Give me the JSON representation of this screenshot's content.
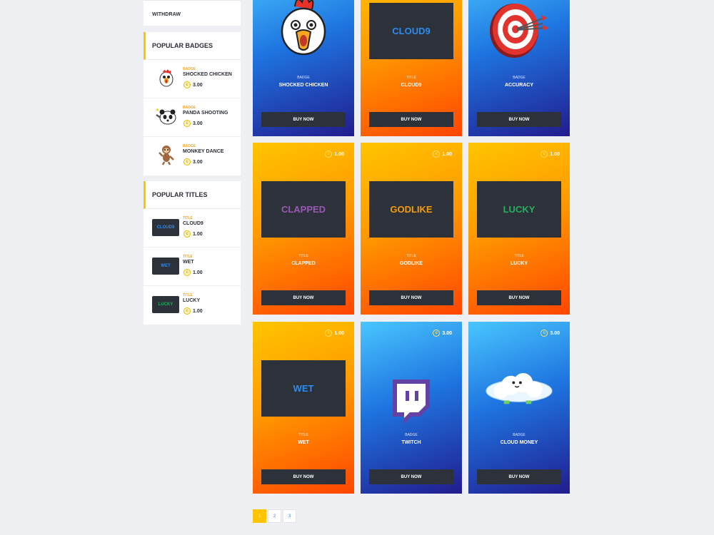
{
  "sidebar": {
    "withdraw_label": "WITHDRAW",
    "badges": {
      "title": "POPULAR BADGES",
      "items": [
        {
          "type": "BADGE",
          "name": "SHOCKED CHICKEN",
          "price": "3.00",
          "icon": "chicken-icon"
        },
        {
          "type": "BADGE",
          "name": "PANDA SHOOTING",
          "price": "3.00",
          "icon": "panda-icon"
        },
        {
          "type": "BADGE",
          "name": "MONKEY DANCE",
          "price": "3.00",
          "icon": "monkey-icon"
        }
      ]
    },
    "titles": {
      "title": "POPULAR TITLES",
      "items": [
        {
          "type": "TITLE",
          "name": "CLOUD9",
          "price": "1.00",
          "thumb": "CLOUD9",
          "color": "#2d8cf0"
        },
        {
          "type": "TITLE",
          "name": "WET",
          "price": "1.00",
          "thumb": "WET",
          "color": "#2d8cf0"
        },
        {
          "type": "TITLE",
          "name": "LUCKY",
          "price": "1.00",
          "thumb": "LUCKY",
          "color": "#27ae60"
        }
      ]
    }
  },
  "cards": [
    {
      "kind": "badge",
      "type": "BADGE",
      "name": "SHOCKED CHICKEN",
      "button": "BUY NOW",
      "icon": "chicken-icon",
      "bg": "blue"
    },
    {
      "kind": "title",
      "type": "TITLE",
      "name": "CLOUD9",
      "button": "BUY NOW",
      "display": "CLOUD9",
      "color": "#2d8cf0",
      "bg": "orange"
    },
    {
      "kind": "badge",
      "type": "BADGE",
      "name": "ACCURACY",
      "button": "BUY NOW",
      "icon": "target-icon",
      "bg": "blue"
    },
    {
      "kind": "title",
      "type": "TITLE",
      "name": "CLAPPED",
      "button": "BUY NOW",
      "display": "CLAPPED",
      "color": "#9b59b6",
      "price": "1.00",
      "bg": "orange"
    },
    {
      "kind": "title",
      "type": "TITLE",
      "name": "GODLIKE",
      "button": "BUY NOW",
      "display": "GODLIKE",
      "color": "#f39c12",
      "price": "1.00",
      "bg": "orange"
    },
    {
      "kind": "title",
      "type": "TITLE",
      "name": "LUCKY",
      "button": "BUY NOW",
      "display": "LUCKY",
      "color": "#27ae60",
      "price": "1.00",
      "bg": "orange"
    },
    {
      "kind": "title",
      "type": "TITLE",
      "name": "WET",
      "button": "BUY NOW",
      "display": "WET",
      "color": "#2d8cf0",
      "price": "1.00",
      "bg": "orange"
    },
    {
      "kind": "badge",
      "type": "BADGE",
      "name": "TWITCH",
      "button": "BUY NOW",
      "icon": "twitch-icon",
      "price": "3.00",
      "bg": "blue"
    },
    {
      "kind": "badge",
      "type": "BADGE",
      "name": "CLOUD MONEY",
      "button": "BUY NOW",
      "icon": "cloud-icon",
      "price": "3.00",
      "bg": "blue"
    }
  ],
  "pagination": [
    "1",
    "2",
    "3"
  ],
  "coin_symbol": "c"
}
